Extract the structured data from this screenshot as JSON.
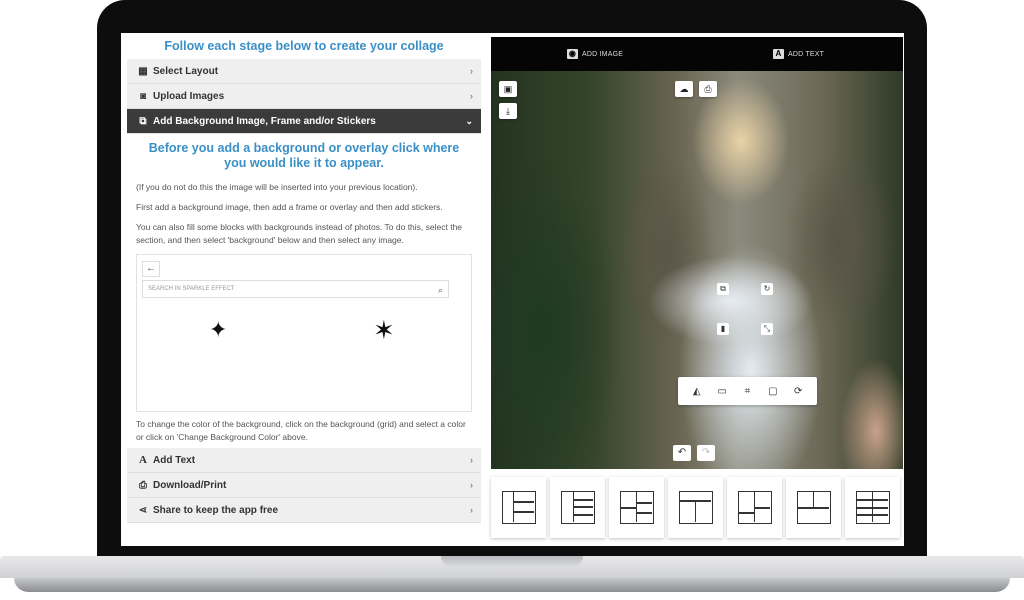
{
  "left": {
    "main_heading": "Follow each stage below to create your collage",
    "accordion_top": [
      {
        "label": "Select Layout",
        "icon": "grid-icon"
      },
      {
        "label": "Upload Images",
        "icon": "camera-icon"
      },
      {
        "label": "Add Background Image, Frame and/or Stickers",
        "icon": "image-stack-icon"
      }
    ],
    "sub_heading": "Before you add a background or overlay click where you would like it to appear.",
    "para1": "(If you do not do this the image will be inserted into your previous location).",
    "para2": "First add a background image, then add a frame or overlay and then add stickers.",
    "para3": "You can also fill some blocks with backgrounds instead of photos. To do this, select the section, and then select 'background' below and then select any image.",
    "search_placeholder": "SEARCH IN SPARKLE EFFECT",
    "footer_text": "To change the color of the background, click on the background (grid) and select a color or click on 'Change Background Color' above.",
    "accordion_bottom": [
      {
        "label": "Add Text",
        "icon": "text-icon"
      },
      {
        "label": "Download/Print",
        "icon": "printer-icon"
      },
      {
        "label": "Share to keep the app free",
        "icon": "share-icon"
      }
    ]
  },
  "right": {
    "topbar": {
      "add_image": "ADD IMAGE",
      "add_text": "ADD TEXT"
    },
    "layouts_count": 7
  },
  "colors": {
    "accent": "#3a8fc6",
    "active_row": "#3b3b3b",
    "topbar": "#050505"
  }
}
